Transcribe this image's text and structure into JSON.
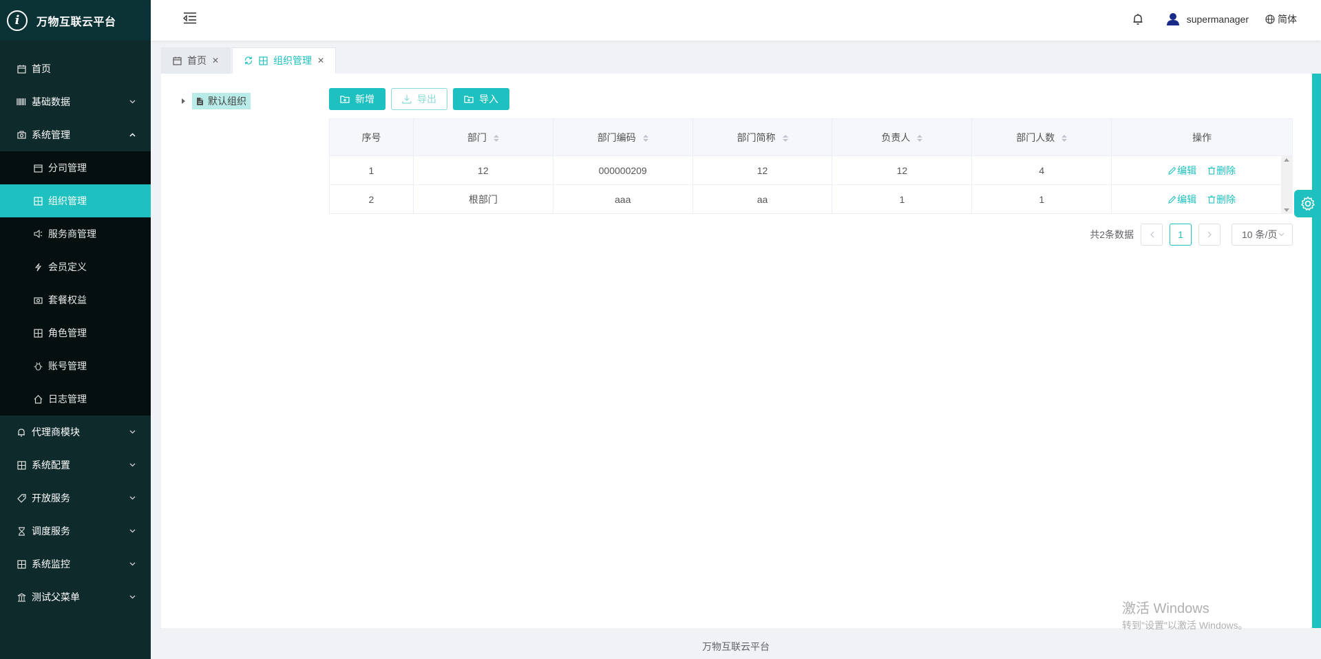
{
  "app": {
    "title": "万物互联云平台",
    "logo_letter": "i"
  },
  "sidebar": {
    "items": [
      {
        "label": "首页",
        "icon": "calendar-icon"
      },
      {
        "label": "基础数据",
        "icon": "barcode-icon"
      },
      {
        "label": "系统管理",
        "icon": "camera-icon",
        "expanded": true
      }
    ],
    "sub_items": [
      {
        "label": "分司管理",
        "icon": "calendar-icon"
      },
      {
        "label": "组织管理",
        "icon": "grid-icon",
        "active": true
      },
      {
        "label": "服务商管理",
        "icon": "speaker-icon"
      },
      {
        "label": "会员定义",
        "icon": "lightning-icon"
      },
      {
        "label": "套餐权益",
        "icon": "camera-icon"
      },
      {
        "label": "角色管理",
        "icon": "grid-icon"
      },
      {
        "label": "账号管理",
        "icon": "bug-icon"
      },
      {
        "label": "日志管理",
        "icon": "home-icon"
      }
    ],
    "bottom_items": [
      {
        "label": "代理商模块",
        "icon": "bell-icon"
      },
      {
        "label": "系统配置",
        "icon": "grid-icon"
      },
      {
        "label": "开放服务",
        "icon": "tag-icon"
      },
      {
        "label": "调度服务",
        "icon": "hourglass-icon"
      },
      {
        "label": "系统监控",
        "icon": "grid-icon"
      },
      {
        "label": "测试父菜单",
        "icon": "bank-icon"
      }
    ]
  },
  "header": {
    "username": "supermanager",
    "language": "简体"
  },
  "tabs": [
    {
      "label": "首页",
      "active": false
    },
    {
      "label": "组织管理",
      "active": true
    }
  ],
  "tree": {
    "root_label": "默认组织"
  },
  "toolbar": {
    "add_label": "新增",
    "export_label": "导出",
    "import_label": "导入"
  },
  "table": {
    "columns": [
      "序号",
      "部门",
      "部门编码",
      "部门简称",
      "负责人",
      "部门人数",
      "操作"
    ],
    "rows": [
      {
        "index": "1",
        "dept": "12",
        "code": "000000209",
        "short": "12",
        "leader": "12",
        "count": "4"
      },
      {
        "index": "2",
        "dept": "根部门",
        "code": "aaa",
        "short": "aa",
        "leader": "1",
        "count": "1"
      }
    ],
    "edit_label": "编辑",
    "delete_label": "删除"
  },
  "pagination": {
    "total_text": "共2条数据",
    "current_page": "1",
    "page_size": "10 条/页"
  },
  "watermark": {
    "line1": "激活 Windows",
    "line2": "转到\"设置\"以激活 Windows。"
  },
  "footer": {
    "text": "万物互联云平台"
  },
  "colors": {
    "accent": "#1ec0c0",
    "sidebar_bg": "#0e2a2b",
    "submenu_bg": "#050f10"
  }
}
